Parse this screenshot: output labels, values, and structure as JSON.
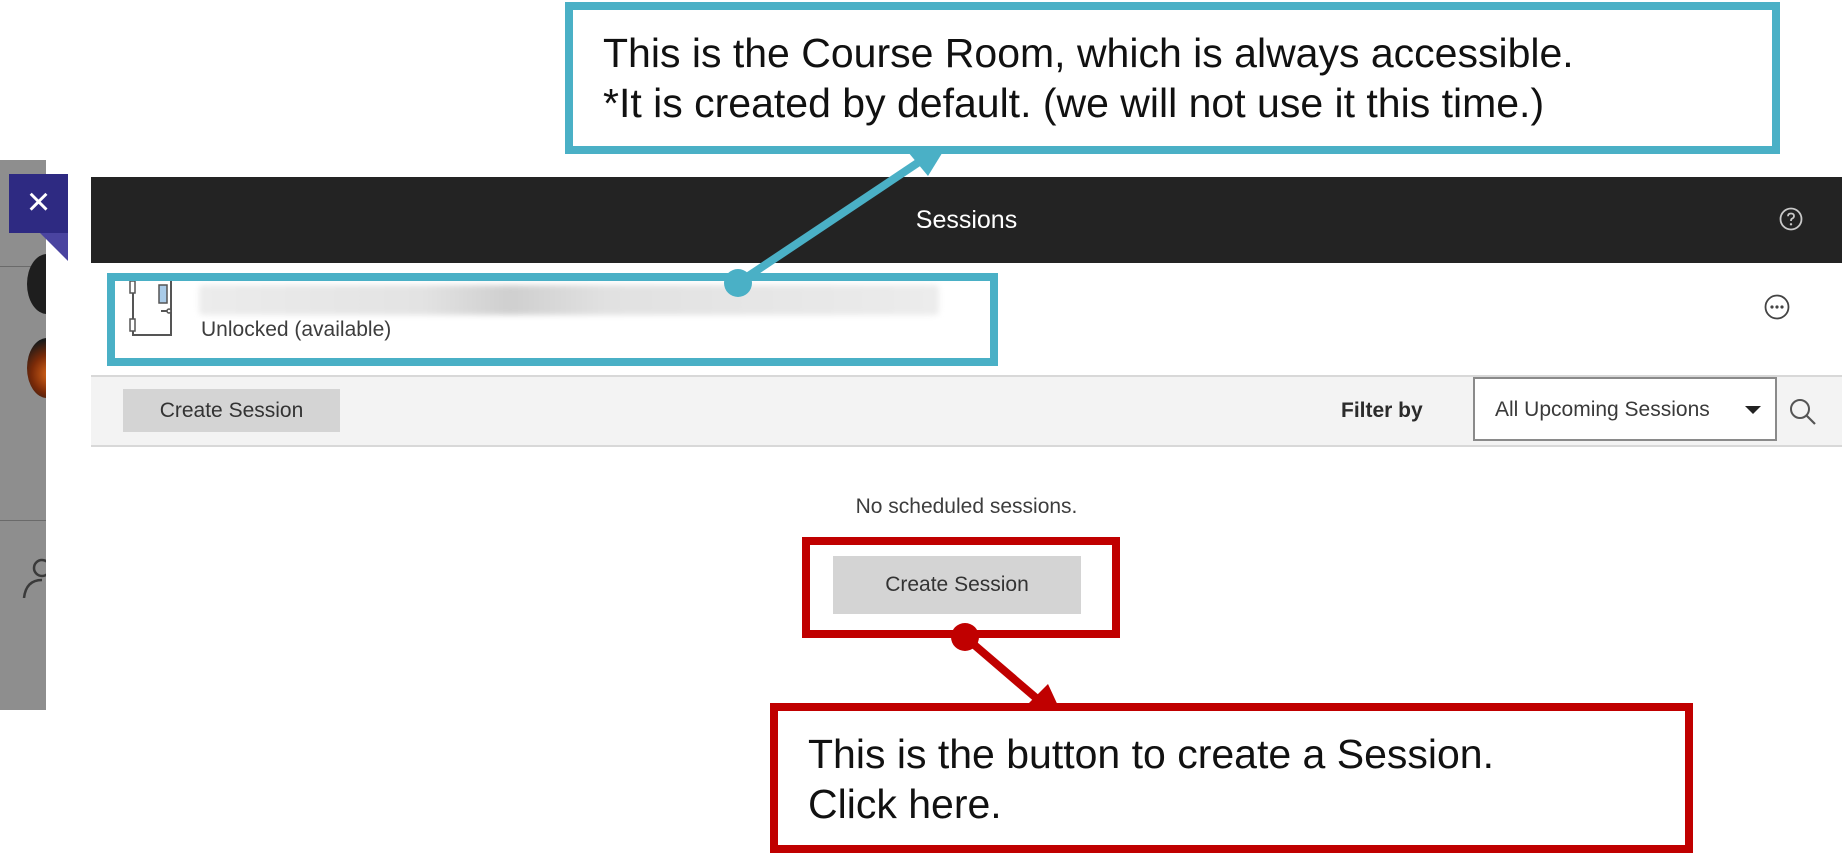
{
  "panel": {
    "title": "Sessions",
    "close_label": "×",
    "course_room": {
      "status": "Unlocked (available)"
    },
    "toolbar": {
      "create_session_label": "Create Session",
      "filter_label": "Filter by",
      "filter_value": "All Upcoming Sessions"
    },
    "empty_message": "No scheduled sessions.",
    "create_session_main_label": "Create Session"
  },
  "annotations": {
    "course_room_callout": {
      "line1": "This is the Course Room, which is always accessible.",
      "line2": "*It is created by default. (we will not use it this time.)"
    },
    "create_session_callout": {
      "line1": "This is the button to create a Session.",
      "line2": "Click here."
    }
  },
  "colors": {
    "header_bg": "#232323",
    "close_button_bg": "#2e2a82",
    "blue_annotation": "#4ab0c6",
    "red_annotation": "#c00000",
    "button_bg": "#d4d4d4"
  },
  "icons": [
    "close-icon",
    "help-icon",
    "door-icon",
    "more-options-icon",
    "dropdown-caret-icon",
    "search-icon"
  ]
}
